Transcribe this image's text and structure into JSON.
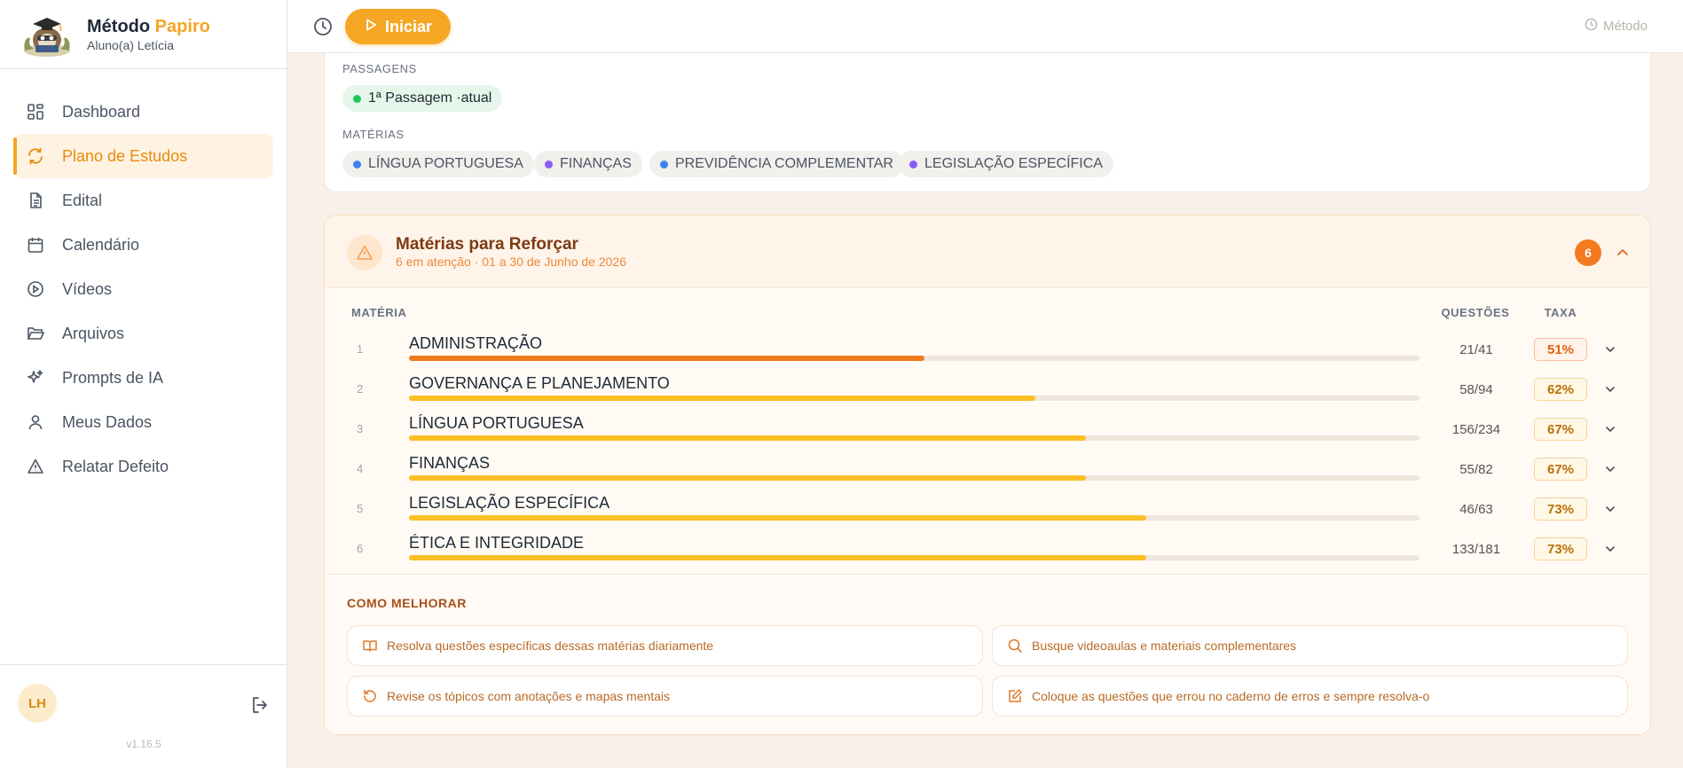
{
  "brand": {
    "name_part1": "Método",
    "name_part2": "Papiro",
    "subtitle": "Aluno(a) Letícia"
  },
  "nav": [
    {
      "label": "Dashboard",
      "icon": "dashboard-icon",
      "active": false
    },
    {
      "label": "Plano de Estudos",
      "icon": "refresh-icon",
      "active": true
    },
    {
      "label": "Edital",
      "icon": "document-icon",
      "active": false
    },
    {
      "label": "Calendário",
      "icon": "calendar-icon",
      "active": false
    },
    {
      "label": "Vídeos",
      "icon": "play-circle-icon",
      "active": false
    },
    {
      "label": "Arquivos",
      "icon": "folder-icon",
      "active": false
    },
    {
      "label": "Prompts de IA",
      "icon": "sparkles-icon",
      "active": false
    },
    {
      "label": "Meus Dados",
      "icon": "user-icon",
      "active": false
    },
    {
      "label": "Relatar Defeito",
      "icon": "warning-icon",
      "active": false
    }
  ],
  "footer": {
    "avatar_initials": "LH",
    "version": "v1.16.5"
  },
  "topbar": {
    "start_label": "Iniciar",
    "right_label": "Método"
  },
  "passagens": {
    "label": "PASSAGENS",
    "current": "1ª Passagem ·atual"
  },
  "materias": {
    "label": "MATÉRIAS",
    "items": [
      {
        "label": "LÍNGUA PORTUGUESA",
        "color": "#3b82f6"
      },
      {
        "label": "FINANÇAS",
        "color": "#8b5cf6"
      },
      {
        "label": "PREVIDÊNCIA COMPLEMENTAR",
        "color": "#3b82f6"
      },
      {
        "label": "LEGISLAÇÃO ESPECÍFICA",
        "color": "#8b5cf6"
      }
    ]
  },
  "reforcar": {
    "title": "Matérias para Reforçar",
    "subtitle": "6 em atenção · 01 a 30 de Junho de 2026",
    "count": "6",
    "headers": {
      "materia": "MATÉRIA",
      "questoes": "QUESTÕES",
      "taxa": "TAXA"
    },
    "rows": [
      {
        "num": "1",
        "name": "ADMINISTRAÇÃO",
        "questions": "21/41",
        "rate": "51%",
        "progress": 0.51,
        "color": "#f07a1c"
      },
      {
        "num": "2",
        "name": "GOVERNANÇA E PLANEJAMENTO",
        "questions": "58/94",
        "rate": "62%",
        "progress": 0.62,
        "color": "#fbbf24"
      },
      {
        "num": "3",
        "name": "LÍNGUA PORTUGUESA",
        "questions": "156/234",
        "rate": "67%",
        "progress": 0.67,
        "color": "#fbbf24"
      },
      {
        "num": "4",
        "name": "FINANÇAS",
        "questions": "55/82",
        "rate": "67%",
        "progress": 0.67,
        "color": "#fbbf24"
      },
      {
        "num": "5",
        "name": "LEGISLAÇÃO ESPECÍFICA",
        "questions": "46/63",
        "rate": "73%",
        "progress": 0.73,
        "color": "#fbbf24"
      },
      {
        "num": "6",
        "name": "ÉTICA E INTEGRIDADE",
        "questions": "133/181",
        "rate": "73%",
        "progress": 0.73,
        "color": "#fbbf24"
      }
    ]
  },
  "melhorar": {
    "title": "COMO MELHORAR",
    "tips": [
      {
        "text": "Resolva questões específicas dessas matérias diariamente",
        "icon": "book-icon"
      },
      {
        "text": "Busque videoaulas e materiais complementares",
        "icon": "search-icon"
      },
      {
        "text": "Revise os tópicos com anotações e mapas mentais",
        "icon": "rotate-icon"
      },
      {
        "text": "Coloque as questões que errou no caderno de erros e sempre resolva-o",
        "icon": "edit-icon"
      }
    ]
  }
}
